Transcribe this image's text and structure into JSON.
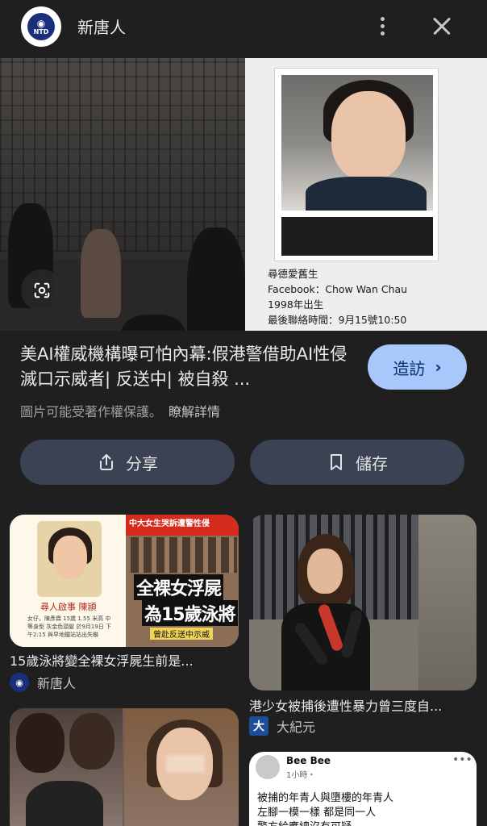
{
  "header": {
    "site_name": "新唐人",
    "logo_text": "NTD",
    "more_icon": "more-vert-icon",
    "close_icon": "close-icon"
  },
  "hero": {
    "overlay_lines": [
      "尋德愛舊生",
      "Facebook：Chow Wan Chau",
      "1998年出生",
      "最後聯絡時間：9月15號10:50"
    ],
    "lens_icon": "google-lens-icon"
  },
  "result": {
    "title": "美AI權威機構曝可怕內幕:假港警借助AI性侵滅口示威者| 反送中| 被自殺 ...",
    "visit_label": "造訪",
    "copyright_notice": "圖片可能受著作權保護。",
    "learn_more": "瞭解詳情"
  },
  "actions": {
    "share_label": "分享",
    "save_label": "儲存"
  },
  "related": [
    {
      "title": "15歲泳將變全裸女浮屍生前是...",
      "source": "新唐人",
      "source_icon": "NTD",
      "overlay": {
        "name": "尋人啟事 陳頴",
        "details": "女仔，陳彥霖 15歲 1.55 米高 中等身型 灰金色頭髮 於9月19日 下午2:15 與早地鐵站站出失聯",
        "headline": "中大女生哭訴遭警性侵",
        "big1": "全裸女浮屍",
        "big2": "為15歲泳將",
        "tag": "曾赴反送中示威"
      }
    },
    {
      "title": "港少女被捕後遭性暴力曾三度自...",
      "source": "大紀元",
      "source_icon": "大"
    },
    {
      "title": "",
      "source": ""
    },
    {
      "post_author": "Bee Bee",
      "post_time": "1小時・",
      "lines": [
        "被捕的年青人與墮樓的年青人",
        "左腳一模一樣 都是同一人",
        "警方給應總沒有可疑"
      ]
    }
  ],
  "colors": {
    "background": "#1f1f1f",
    "primary_button": "#a8c7fa",
    "secondary_button": "#3b4253"
  }
}
